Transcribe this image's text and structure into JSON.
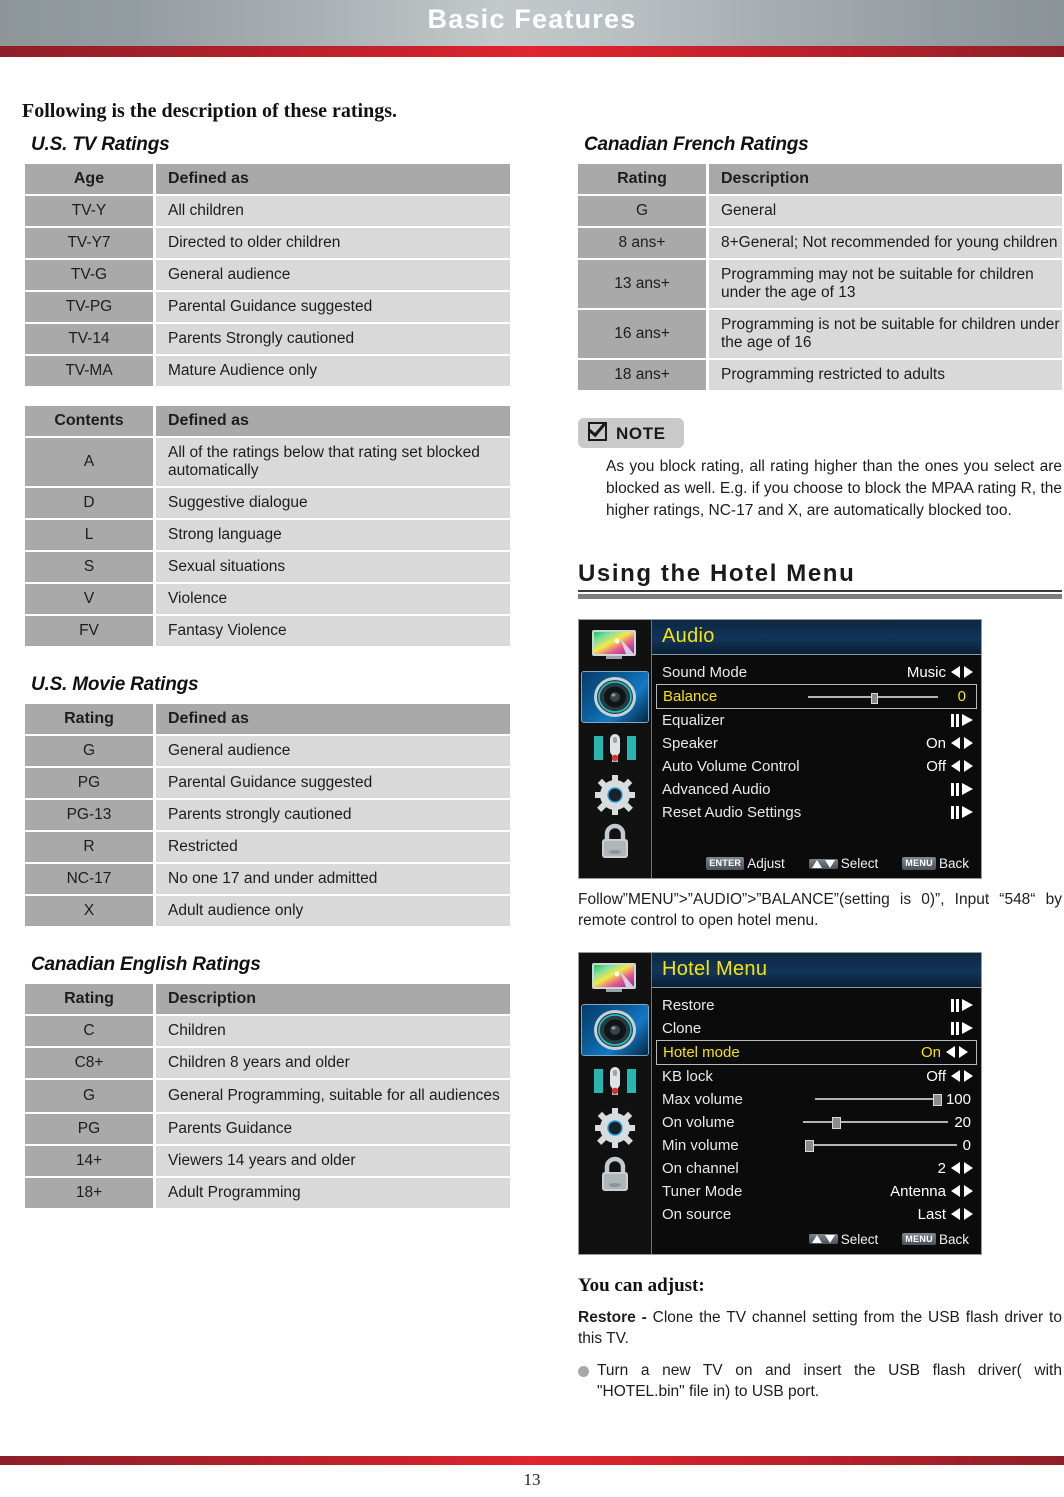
{
  "page": {
    "header_title": "Basic Features",
    "page_number": "13",
    "intro_line": "Following is the description of these ratings."
  },
  "left_column": {
    "us_tv_ratings": {
      "title": "U.S. TV Ratings",
      "headers": [
        "Age",
        "Defined as"
      ],
      "rows": [
        [
          "TV-Y",
          "All children"
        ],
        [
          "TV-Y7",
          "Directed to older children"
        ],
        [
          "TV-G",
          "General audience"
        ],
        [
          "TV-PG",
          "Parental Guidance suggested"
        ],
        [
          "TV-14",
          "Parents Strongly cautioned"
        ],
        [
          "TV-MA",
          "Mature Audience only"
        ]
      ]
    },
    "us_tv_contents": {
      "headers": [
        "Contents",
        "Defined as"
      ],
      "rows": [
        [
          "A",
          "All of the ratings below that rating set blocked automatically"
        ],
        [
          "D",
          "Suggestive dialogue"
        ],
        [
          "L",
          "Strong language"
        ],
        [
          "S",
          "Sexual situations"
        ],
        [
          "V",
          "Violence"
        ],
        [
          "FV",
          "Fantasy Violence"
        ]
      ]
    },
    "us_movie_ratings": {
      "title": "U.S. Movie Ratings",
      "headers": [
        "Rating",
        "Defined as"
      ],
      "rows": [
        [
          "G",
          "General audience"
        ],
        [
          "PG",
          "Parental Guidance suggested"
        ],
        [
          "PG-13",
          "Parents strongly cautioned"
        ],
        [
          "R",
          "Restricted"
        ],
        [
          "NC-17",
          "No one 17 and under admitted"
        ],
        [
          "X",
          "Adult audience only"
        ]
      ]
    },
    "canadian_english_ratings": {
      "title": "Canadian English Ratings",
      "headers": [
        "Rating",
        "Description"
      ],
      "rows": [
        [
          "C",
          "Children"
        ],
        [
          "C8+",
          "Children 8 years and older"
        ],
        [
          "G",
          "General Programming, suitable for all audiences"
        ],
        [
          "PG",
          "Parents Guidance"
        ],
        [
          "14+",
          "Viewers 14 years and older"
        ],
        [
          "18+",
          "Adult Programming"
        ]
      ]
    }
  },
  "right_column": {
    "canadian_french_ratings": {
      "title": "Canadian French Ratings",
      "headers": [
        "Rating",
        "Description"
      ],
      "rows": [
        [
          "G",
          "General"
        ],
        [
          "8 ans+",
          "8+General; Not recommended for young children"
        ],
        [
          "13 ans+",
          "Programming may not be suitable for children under the age of 13"
        ],
        [
          "16 ans+",
          "Programming is not be suitable for children under the age of 16"
        ],
        [
          "18 ans+",
          "Programming restricted to adults"
        ]
      ]
    },
    "note": {
      "label": "NOTE",
      "body": "As you block rating, all rating higher than the ones you select are blocked as well. E.g. if you choose to block the MPAA rating R, the higher ratings, NC-17 and X, are automatically blocked too."
    },
    "hotel_section": {
      "heading": "Using the Hotel Menu",
      "follow_text": "Follow”MENU”>”AUDIO”>”BALANCE”(setting is 0)”, Input “548“ by remote control to open hotel menu.",
      "adjust_heading": "You can adjust:",
      "restore_label": "Restore - ",
      "restore_text": "Clone the TV channel setting from the USB flash driver to this TV.",
      "bullet_text": "Turn a new TV on and insert the USB flash driver( with \"HOTEL.bin\" file in) to USB port."
    },
    "audio_osd": {
      "title": "Audio",
      "sidebar_icons": [
        "picture-icon",
        "audio-icon",
        "channel-icon",
        "settings-icon",
        "lock-icon"
      ],
      "selected_sidebar_index": 1,
      "rows": [
        {
          "label": "Sound Mode",
          "value": "Music",
          "control": "lr-arrows",
          "highlight": false
        },
        {
          "label": "Balance",
          "value": "0",
          "control": "slider",
          "slider_percent": 50,
          "highlight": true
        },
        {
          "label": "Equalizer",
          "value": "",
          "control": "submenu",
          "highlight": false
        },
        {
          "label": "Speaker",
          "value": "On",
          "control": "lr-arrows",
          "highlight": false
        },
        {
          "label": "Auto Volume Control",
          "value": "Off",
          "control": "lr-arrows",
          "highlight": false
        },
        {
          "label": "Advanced Audio",
          "value": "",
          "control": "submenu",
          "highlight": false
        },
        {
          "label": "Reset Audio Settings",
          "value": "",
          "control": "submenu",
          "highlight": false
        }
      ],
      "hints": [
        {
          "key": "ENTER",
          "text": "Adjust"
        },
        {
          "key": "UPDOWN",
          "text": "Select"
        },
        {
          "key": "MENU",
          "text": "Back"
        }
      ]
    },
    "hotel_osd": {
      "title": "Hotel Menu",
      "sidebar_icons": [
        "picture-icon",
        "audio-icon",
        "channel-icon",
        "settings-icon",
        "lock-icon"
      ],
      "selected_sidebar_index": 1,
      "rows": [
        {
          "label": "Restore",
          "value": "",
          "control": "submenu",
          "highlight": false
        },
        {
          "label": "Clone",
          "value": "",
          "control": "submenu",
          "highlight": false
        },
        {
          "label": "Hotel mode",
          "value": "On",
          "control": "lr-arrows",
          "highlight": true
        },
        {
          "label": "KB lock",
          "value": "Off",
          "control": "lr-arrows",
          "highlight": false
        },
        {
          "label": "Max volume",
          "value": "100",
          "control": "slider",
          "slider_percent": 100,
          "highlight": false
        },
        {
          "label": "On volume",
          "value": "20",
          "control": "slider",
          "slider_percent": 20,
          "highlight": false
        },
        {
          "label": "Min volume",
          "value": "0",
          "control": "slider",
          "slider_percent": 0,
          "highlight": false
        },
        {
          "label": "On channel",
          "value": "2",
          "control": "lr-arrows",
          "highlight": false
        },
        {
          "label": "Tuner Mode",
          "value": "Antenna",
          "control": "lr-arrows",
          "highlight": false
        },
        {
          "label": "On source",
          "value": "Last",
          "control": "lr-arrows",
          "highlight": false
        }
      ],
      "hints": [
        {
          "key": "UPDOWN",
          "text": "Select"
        },
        {
          "key": "MENU",
          "text": "Back"
        }
      ]
    }
  }
}
